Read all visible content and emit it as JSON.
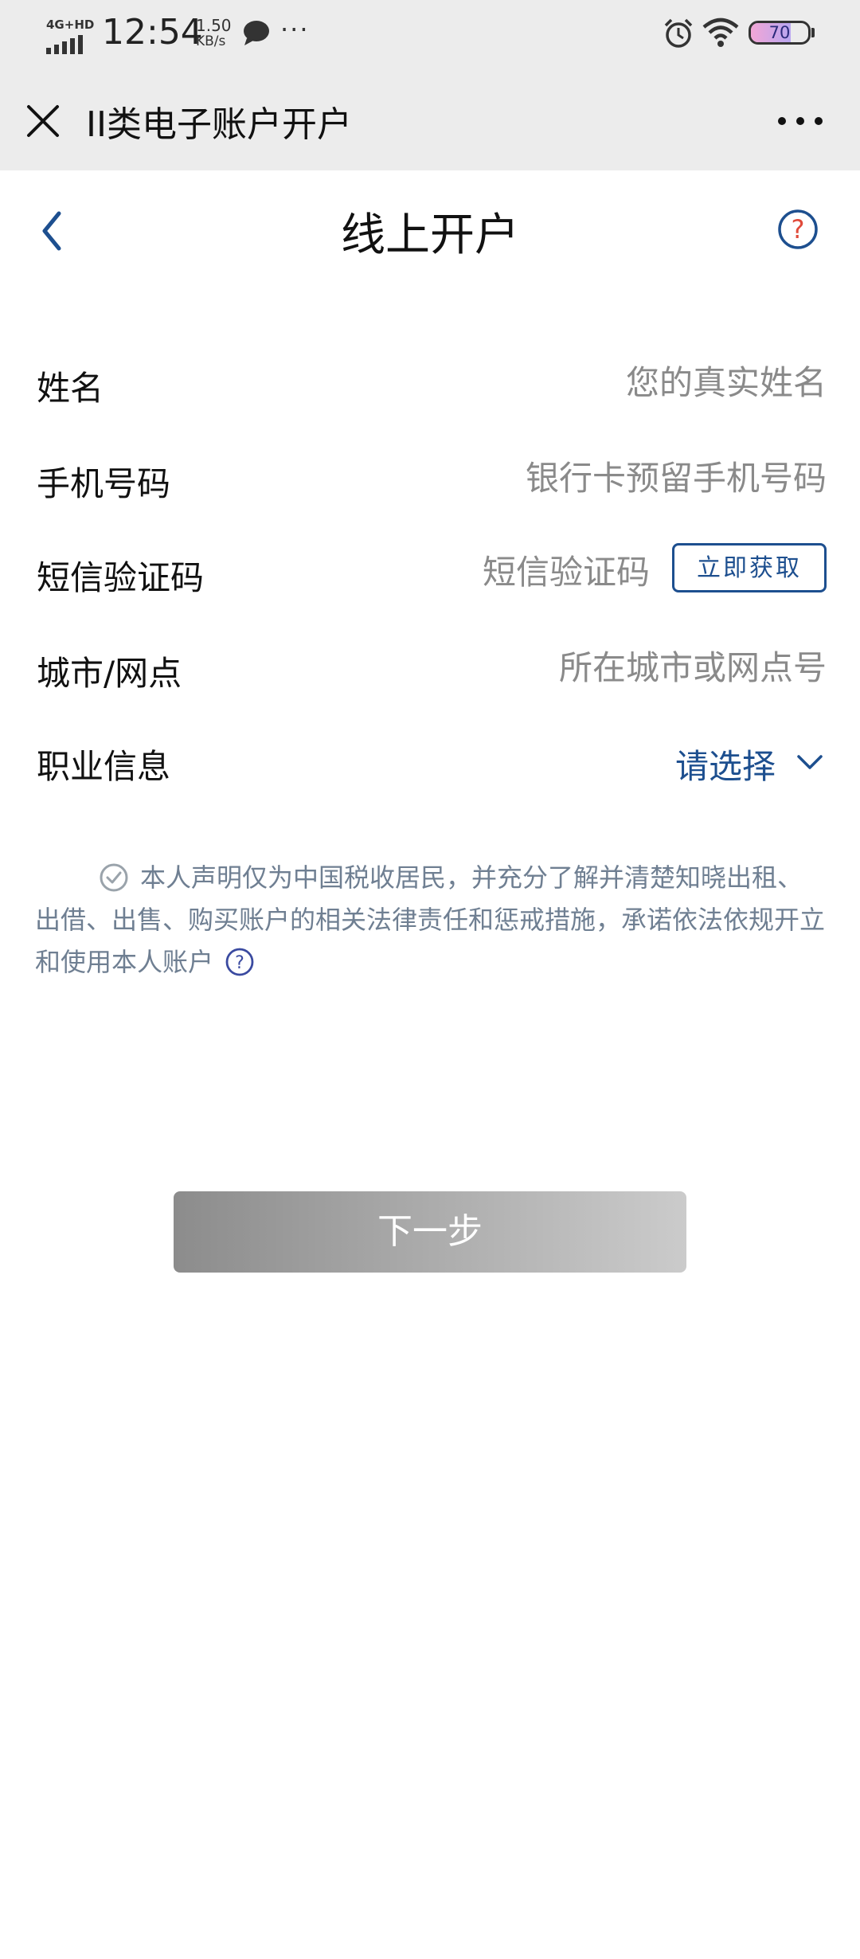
{
  "status_bar": {
    "network": "4G+HD",
    "time": "12:54",
    "speed_value": "1.50",
    "speed_unit": "KB/s",
    "more": "···",
    "battery_level": "70"
  },
  "app_bar": {
    "title": "II类电子账户开户",
    "close_icon": "close-icon",
    "more_icon": "more-horizontal-icon"
  },
  "page": {
    "title": "线上开户",
    "back_icon": "chevron-left-icon",
    "help_icon": "question-circle-icon"
  },
  "form": {
    "name": {
      "label": "姓名",
      "placeholder": "您的真实姓名"
    },
    "phone": {
      "label": "手机号码",
      "placeholder": "银行卡预留手机号码"
    },
    "sms": {
      "label": "短信验证码",
      "placeholder": "短信验证码",
      "button": "立即获取"
    },
    "city": {
      "label": "城市/网点",
      "placeholder": "所在城市或网点号"
    },
    "occupation": {
      "label": "职业信息",
      "value": "请选择"
    }
  },
  "declaration": {
    "text": "本人声明仅为中国税收居民，并充分了解并清楚知晓出租、出借、出售、购买账户的相关法律责任和惩戒措施，承诺依法依规开立和使用本人账户",
    "checked": false
  },
  "next_button": {
    "label": "下一步",
    "enabled": false
  },
  "colors": {
    "accent": "#1d4f8f",
    "top_bar_bg": "#ececec",
    "declaration_text": "#6f7f92",
    "placeholder": "#8a8a8a",
    "help_red": "#e04a3a"
  }
}
